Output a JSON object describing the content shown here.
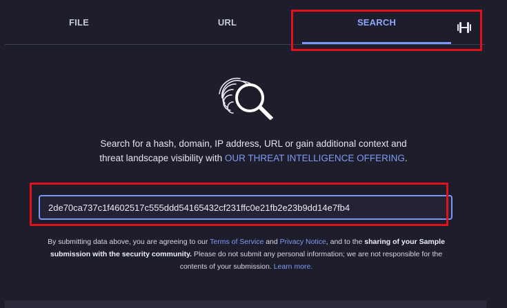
{
  "tabs": {
    "file": "FILE",
    "url": "URL",
    "search": "SEARCH",
    "extra_icon": "dumbbell-api-icon"
  },
  "illustration": {
    "icon": "fingerprint-search-icon"
  },
  "description": {
    "text_before": "Search for a hash, domain, IP address, URL or gain additional context and threat landscape visibility with ",
    "link": "OUR THREAT INTELLIGENCE OFFERING",
    "text_after": "."
  },
  "search": {
    "value": "2de70ca737c1f4602517c555ddd54165432cf231ffc0e21fb2e23b9dd14e7fb4"
  },
  "notice": {
    "part1": "By submitting data above, you are agreeing to our ",
    "terms": "Terms of Service",
    "and": " and ",
    "privacy": "Privacy Notice",
    "part2": ", and to the ",
    "bold": "sharing of your Sample submission with the security community.",
    "part3": " Please do not submit any personal information; we are not responsible for the contents of your submission. ",
    "learn_more": "Learn more."
  },
  "colors": {
    "background": "#1e1d2b",
    "accent": "#7d97f5",
    "highlight": "#e0121b"
  }
}
